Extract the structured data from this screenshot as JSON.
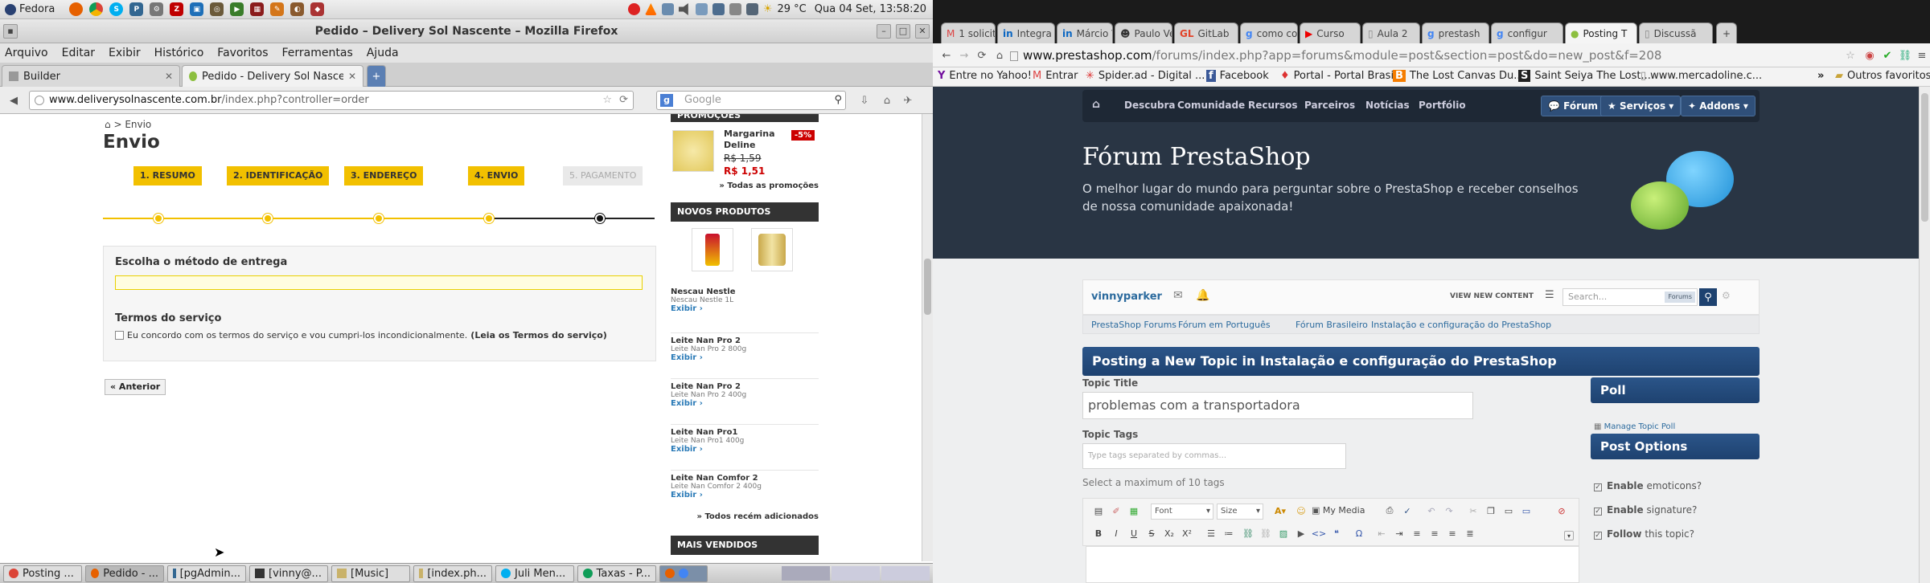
{
  "top_panel": {
    "menu_label": "Fedora",
    "temperature": "29 °C",
    "datetime": "Qua 04 Set, 13:58:20"
  },
  "left_window": {
    "title": "Pedido – Delivery Sol Nascente – Mozilla Firefox",
    "menu": [
      "Arquivo",
      "Editar",
      "Exibir",
      "Histórico",
      "Favoritos",
      "Ferramentas",
      "Ajuda"
    ],
    "tabs": [
      {
        "label": "Builder"
      },
      {
        "label": "Pedido - Delivery Sol Nascente..."
      }
    ],
    "url_host": "www.deliverysolnascente.com.br",
    "url_path": "/index.php?controller=order",
    "search_placeholder": "Google",
    "page": {
      "breadcrumb_current": "Envio",
      "heading": "Envio",
      "steps": [
        "1. RESUMO",
        "2. IDENTIFICAÇÃO",
        "3. ENDEREÇO",
        "4. ENVIO",
        "5. PAGAMENTO"
      ],
      "delivery_title": "Escolha o método de entrega",
      "terms_title": "Termos do serviço",
      "terms_text": "Eu concordo com os termos do serviço e vou cumpri-los incondicionalmente.",
      "terms_link": "(Leia os Termos do serviço)",
      "back_button": "« Anterior",
      "sidebar": {
        "promo_header": "PROMOÇÕES",
        "promo_product": "Margarina Deline",
        "promo_discount": "-5%",
        "promo_old_price": "R$ 1,59",
        "promo_new_price": "R$ 1,51",
        "all_promos": "» Todas as promoções",
        "new_header": "NOVOS PRODUTOS",
        "products": [
          {
            "name": "Nescau Nestle",
            "sub": "Nescau Nestle 1L",
            "link": "Exibir"
          },
          {
            "name": "Leite Nan Pro 2",
            "sub": "Leite Nan Pro 2 800g",
            "link": "Exibir"
          },
          {
            "name": "Leite Nan Pro 2",
            "sub": "Leite Nan Pro 2 400g",
            "link": "Exibir"
          },
          {
            "name": "Leite Nan Pro1",
            "sub": "Leite Nan Pro1 400g",
            "link": "Exibir"
          },
          {
            "name": "Leite Nan Comfor 2",
            "sub": "Leite Nan Comfor 2 400g",
            "link": "Exibir"
          }
        ],
        "all_new": "» Todos recém adicionados",
        "bestsellers_header": "MAIS VENDIDOS"
      }
    }
  },
  "taskbar": {
    "items": [
      "Posting ...",
      "Pedido - ...",
      "[pgAdmin...",
      "[vinny@...",
      "[Music]",
      "[index.ph...",
      "Juli Men...",
      "Taxas - P..."
    ]
  },
  "right_window": {
    "tabs": [
      "1 solicit",
      "Integra",
      "Márcio V",
      "Paulo Ve",
      "GitLab",
      "como co",
      "Curso",
      "Aula 2",
      "prestash",
      "configur",
      "Posting T",
      "Discussã"
    ],
    "url_host": "www.prestashop.com",
    "url_path": "/forums/index.php?app=forums&module=post&section=post&do=new_post&f=208",
    "bookmarks": [
      "Entre no Yahoo!",
      "Entrar",
      "Spider.ad - Digital ...",
      "Facebook",
      "Portal - Portal Brasi...",
      "The Lost Canvas Du...",
      "Saint Seiya The Lost...",
      "www.mercadoline.c...",
      "Outros favoritos"
    ],
    "page": {
      "nav": [
        "Descubra",
        "Comunidade",
        "Recursos",
        "Parceiros",
        "Notícias",
        "Portfólio"
      ],
      "nav_buttons": [
        "Fórum",
        "Serviços",
        "Addons"
      ],
      "forum_title": "Fórum PrestaShop",
      "forum_tagline": "O melhor lugar do mundo para perguntar sobre o PrestaShop e receber conselhos de nossa comunidade apaixonada!",
      "username": "vinnyparker",
      "view_new": "VIEW NEW CONTENT",
      "search_placeholder": "Search...",
      "search_scope": "Forums",
      "crumbs": [
        "PrestaShop Forums",
        "Fórum em Português",
        "Fórum Brasileiro",
        "Instalação e configuração do PrestaShop"
      ],
      "post_header": "Posting a New Topic in Instalação e configuração do PrestaShop",
      "topic_title_label": "Topic Title",
      "topic_title_value": "problemas com a transportadora",
      "topic_tags_label": "Topic Tags",
      "topic_tags_placeholder": "Type tags separated by commas...",
      "tags_hint": "Select a maximum of 10 tags",
      "font_select": "Font",
      "size_select": "Size",
      "my_media": "My Media",
      "poll_header": "Poll",
      "manage_poll": "Manage Topic Poll",
      "post_options_header": "Post Options",
      "options": [
        {
          "prefix": "Enable",
          "rest": " emoticons?"
        },
        {
          "prefix": "Enable",
          "rest": " signature?"
        },
        {
          "prefix": "Follow",
          "rest": " this topic?"
        }
      ]
    }
  },
  "colors": {
    "step_yellow": "#f2c000",
    "forum_dark": "#293544",
    "forum_blue": "#2b5589"
  }
}
